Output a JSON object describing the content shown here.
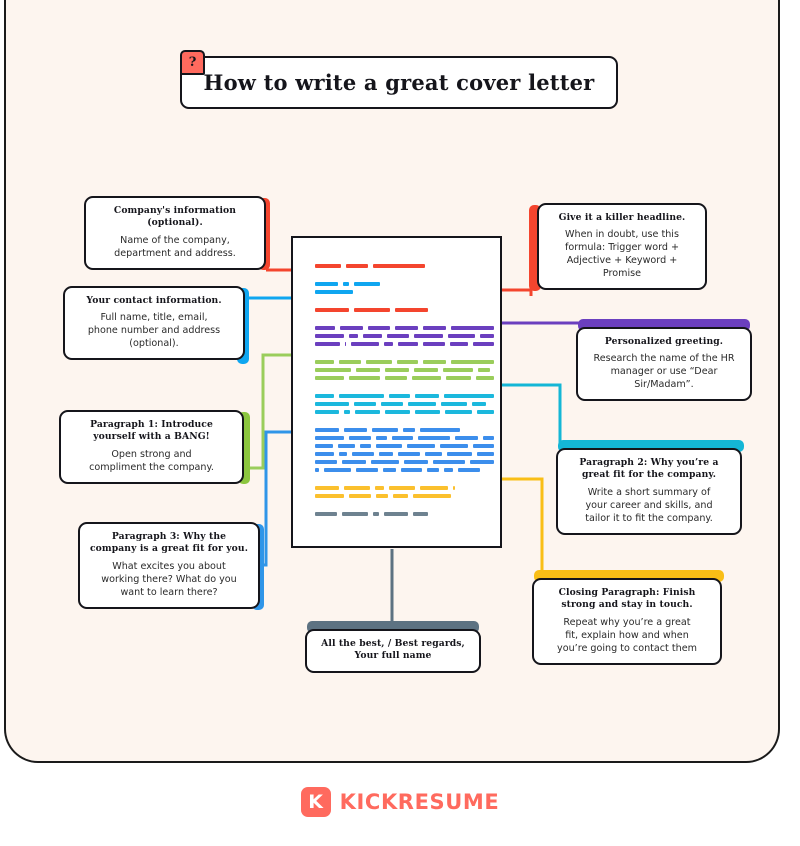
{
  "page": {
    "background": "#FDF5EF",
    "border_color": "#15151B"
  },
  "header": {
    "badge": "?",
    "title": "How to write a great cover letter"
  },
  "footer": {
    "logo_mark": "K",
    "logo_text": "KICKRESUME",
    "brand_color": "#FF6A5E"
  },
  "callouts": [
    {
      "id": "company-information",
      "heading": "Company's information (optional).",
      "body": "Name of the company, department and address.",
      "accent": "#F4452E",
      "accent_side": "right"
    },
    {
      "id": "your-contact-information",
      "heading": "Your contact information.",
      "body": "Full name, title, email, phone number and address (optional).",
      "accent": "#0FA6F0",
      "accent_side": "right"
    },
    {
      "id": "paragraph-1",
      "heading": "Paragraph 1: Introduce yourself with a BANG!",
      "body": "Open strong and compliment the company.",
      "accent": "#8CC councilC"
    },
    {
      "id": "paragraph-3",
      "heading": "Paragraph 3: Why the company is a great fit for you.",
      "body": "What excites you about working there? What do you want to learn there?",
      "accent": "#2F95E8",
      "accent_side": "right"
    },
    {
      "id": "killer-headline",
      "heading": "Give it a killer headline.",
      "body": "When in doubt, use this formula: Trigger word + Adjective + Keyword + Promise",
      "accent": "#F4452E",
      "accent_side": "left"
    },
    {
      "id": "personalized-greeting",
      "heading": "Personalized greeting.",
      "body": "Research the name of the HR manager or use “Dear Sir/Madam”.",
      "accent": "#6B3FBF",
      "accent_side": "top"
    },
    {
      "id": "paragraph-2",
      "heading": "Paragraph 2: Why you’re a great fit for the company.",
      "body": "Write a short summary of your career and skills, and tailor it to fit the company.",
      "accent": "#14B6D6",
      "accent_side": "top"
    },
    {
      "id": "closing-paragraph",
      "heading": "Closing Paragraph: Finish strong and stay in touch.",
      "body": "Repeat why you’re a great fit, explain how and when you’re going to contact them",
      "accent": "#F9BE16",
      "accent_side": "top"
    },
    {
      "id": "signature",
      "heading": "All the best, / Best regards, Your full name",
      "body": "",
      "accent": "#5D7282",
      "accent_side": "top"
    }
  ],
  "callout_text": {
    "company_information": {
      "heading_line1": "Company's information",
      "heading_line2": "(optional).",
      "body_line1": "Name of the company,",
      "body_line2": "department and address."
    },
    "contact_information": {
      "heading_line1": "Your contact information.",
      "body_line1": "Full name, title, email,",
      "body_line2": "phone number and address",
      "body_line3": "(optional)."
    },
    "paragraph1": {
      "heading_line1": "Paragraph 1: Introduce",
      "heading_line2": "yourself with a BANG!",
      "body_line1": "Open strong and",
      "body_line2": "compliment the company."
    },
    "paragraph3": {
      "heading_line1": "Paragraph 3: Why the",
      "heading_line2": "company is a great fit for you.",
      "body_line1": "What excites you about",
      "body_line2": "working there? What do you",
      "body_line3": "want to learn there?"
    },
    "headline": {
      "heading_line1": "Give it a killer headline.",
      "body_line1": "When in doubt, use this",
      "body_line2": "formula: Trigger word +",
      "body_line3": "Adjective + Keyword +",
      "body_line4": "Promise"
    },
    "greeting": {
      "heading_line1": "Personalized greeting.",
      "body_line1": "Research the name of the HR",
      "body_line2": "manager or use “Dear",
      "body_line3": "Sir/Madam”."
    },
    "paragraph2": {
      "heading_line1": "Paragraph 2: Why you’re a",
      "heading_line2": "great fit for the company.",
      "body_line1": "Write a short summary of",
      "body_line2": "your career and skills, and",
      "body_line3": "tailor it to fit the company."
    },
    "closing": {
      "heading_line1": "Closing Paragraph: Finish",
      "heading_line2": "strong and stay in touch.",
      "body_line1": "Repeat why you’re a great",
      "body_line2": "fit, explain how and when",
      "body_line3": "you’re going to contact them"
    },
    "signature": {
      "heading_line1": "All the best, / Best regards,",
      "heading_line2": "Your full name"
    }
  },
  "letter": {
    "colors": {
      "red": "#F4452E",
      "lightblue": "#0FA6F0",
      "purple": "#6B3FBF",
      "green": "#9ACD5B",
      "cyan": "#1BB8DD",
      "blue": "#3C8EEC",
      "yellow": "#FBC02D",
      "gray": "#6E8290"
    },
    "blocks": [
      {
        "color": "red",
        "rows": [
          [
            26,
            22,
            52
          ]
        ]
      },
      {
        "color": "lightblue",
        "rows": [
          [
            23,
            6,
            26
          ],
          [
            38
          ]
        ]
      },
      {
        "color": "red",
        "rows": [
          [
            34,
            36,
            33
          ]
        ]
      },
      {
        "color": "purple",
        "rows": [
          [
            22,
            25,
            24,
            25,
            25,
            47
          ],
          [
            29,
            9,
            19,
            22,
            29,
            27,
            14
          ],
          [
            28,
            2,
            32,
            10,
            22,
            26,
            20,
            24
          ]
        ]
      },
      {
        "color": "green",
        "rows": [
          [
            21,
            24,
            28,
            23,
            25,
            47
          ],
          [
            36,
            24,
            24,
            24,
            30,
            12
          ],
          [
            32,
            33,
            24,
            32,
            27,
            20
          ]
        ]
      },
      {
        "color": "cyan",
        "rows": [
          [
            20,
            47,
            22,
            25,
            52
          ],
          [
            34,
            22,
            22,
            28,
            26,
            14
          ],
          [
            25,
            6,
            26,
            26,
            26,
            28,
            18
          ]
        ]
      },
      {
        "color": "blue",
        "rows": [
          [
            24,
            23,
            26,
            12,
            40
          ],
          [
            33,
            24,
            12,
            24,
            36,
            26,
            12
          ],
          [
            19,
            18,
            12,
            28,
            30,
            30,
            22
          ],
          [
            20,
            8,
            24,
            15,
            23,
            18,
            26,
            18
          ],
          [
            22,
            24,
            28,
            24,
            32,
            24
          ],
          [
            4,
            27,
            22,
            13,
            21,
            12,
            9,
            22
          ]
        ]
      },
      {
        "color": "yellow",
        "rows": [
          [
            24,
            26,
            9,
            26,
            28,
            2
          ],
          [
            29,
            22,
            12,
            15,
            38
          ]
        ]
      },
      {
        "color": "gray",
        "rows": [
          [
            22,
            26,
            6,
            24,
            15
          ]
        ]
      }
    ]
  }
}
